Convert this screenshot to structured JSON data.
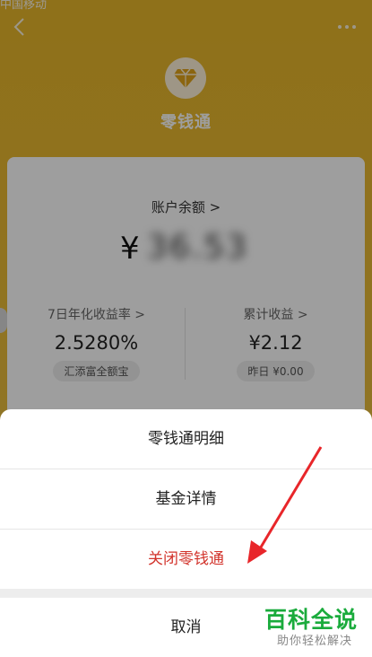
{
  "header": {
    "status_fragment": "中国移动",
    "title": "零钱通"
  },
  "balance": {
    "label": "账户余额 >",
    "currency": "¥",
    "amount_blurred": "36.53"
  },
  "metrics": {
    "left": {
      "label": "7日年化收益率 >",
      "value": "2.5280%",
      "chip": "汇添富全额宝"
    },
    "right": {
      "label": "累计收益 >",
      "value": "¥2.12",
      "chip": "昨日 ¥0.00"
    }
  },
  "sheet": {
    "options": [
      "零钱通明细",
      "基金详情",
      "关闭零钱通"
    ],
    "cancel": "取消"
  },
  "watermark": {
    "main": "百科全说",
    "sub": "助你轻松解决"
  },
  "colors": {
    "theme_yellow": "#e8ba34",
    "danger_red": "#d2332b",
    "watermark_green": "#1aab3c"
  }
}
